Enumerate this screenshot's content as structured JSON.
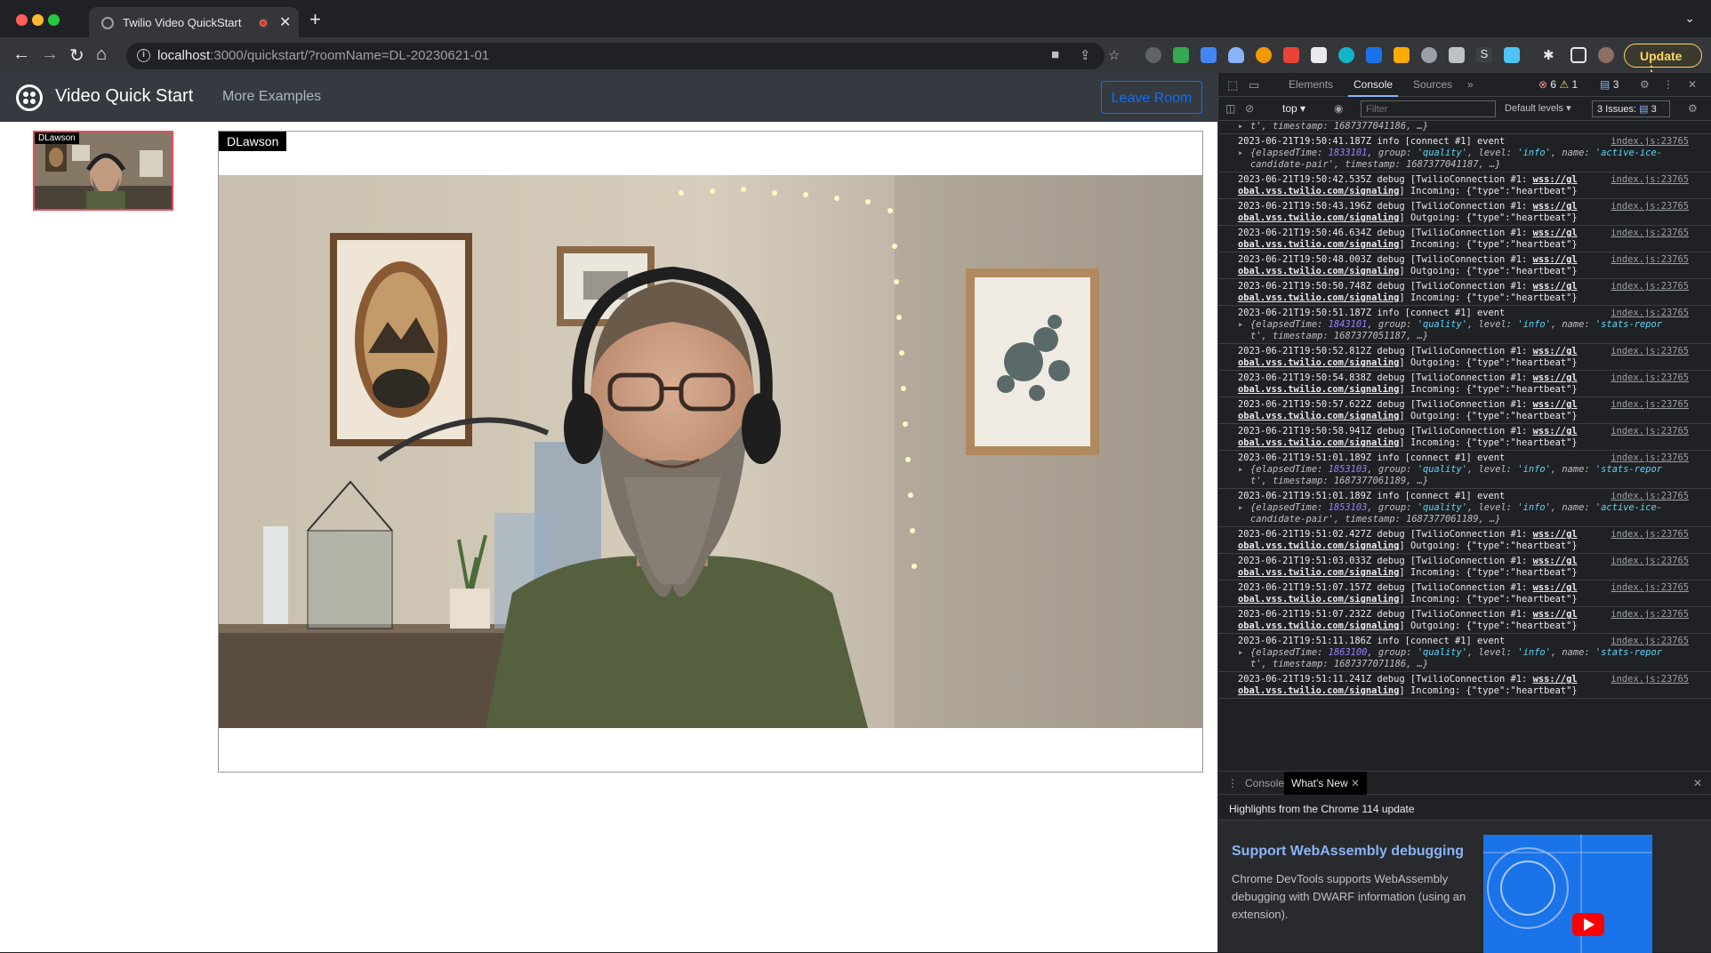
{
  "browser": {
    "tab_title": "Twilio Video QuickStart",
    "url_host": "localhost",
    "url_rest": ":3000/quickstart/?roomName=DL-20230621-01",
    "update_label": "Update"
  },
  "app": {
    "brand": "Video Quick Start",
    "more_examples": "More Examples",
    "leave_room": "Leave Room",
    "local_participant": "DLawson",
    "main_participant": "DLawson"
  },
  "devtools": {
    "tabs": [
      "Elements",
      "Console",
      "Sources"
    ],
    "error_count": "6",
    "warning_count": "1",
    "info_count": "3",
    "context": "top",
    "filter_placeholder": "Filter",
    "levels": "Default levels",
    "issues": "3 Issues:",
    "issues_count": "3",
    "truncated_line": "t', timestamp: 1687377041186, …}",
    "console_entries": [
      {
        "kind": "event",
        "ts": "2023-06-21T19:50:41.187Z",
        "src": "index.js:23765",
        "elapsed": "1833101",
        "name_val": "'active-ice-",
        "tail": "candidate-pair', timestamp: 1687377041187, …}"
      },
      {
        "kind": "hb",
        "ts": "2023-06-21T19:50:42.535Z",
        "src": "index.js:23765",
        "dir": "Incoming"
      },
      {
        "kind": "hb",
        "ts": "2023-06-21T19:50:43.196Z",
        "src": "index.js:23765",
        "dir": "Outgoing"
      },
      {
        "kind": "hb",
        "ts": "2023-06-21T19:50:46.634Z",
        "src": "index.js:23765",
        "dir": "Incoming"
      },
      {
        "kind": "hb",
        "ts": "2023-06-21T19:50:48.003Z",
        "src": "index.js:23765",
        "dir": "Outgoing"
      },
      {
        "kind": "hb",
        "ts": "2023-06-21T19:50:50.748Z",
        "src": "index.js:23765",
        "dir": "Incoming"
      },
      {
        "kind": "event",
        "ts": "2023-06-21T19:50:51.187Z",
        "src": "index.js:23765",
        "elapsed": "1843101",
        "name_val": "'stats-repor",
        "tail": "t', timestamp: 1687377051187, …}"
      },
      {
        "kind": "hb",
        "ts": "2023-06-21T19:50:52.812Z",
        "src": "index.js:23765",
        "dir": "Outgoing"
      },
      {
        "kind": "hb",
        "ts": "2023-06-21T19:50:54.838Z",
        "src": "index.js:23765",
        "dir": "Incoming"
      },
      {
        "kind": "hb",
        "ts": "2023-06-21T19:50:57.622Z",
        "src": "index.js:23765",
        "dir": "Outgoing"
      },
      {
        "kind": "hb",
        "ts": "2023-06-21T19:50:58.941Z",
        "src": "index.js:23765",
        "dir": "Incoming"
      },
      {
        "kind": "event",
        "ts": "2023-06-21T19:51:01.189Z",
        "src": "index.js:23765",
        "elapsed": "1853103",
        "name_val": "'stats-repor",
        "tail": "t', timestamp: 1687377061189, …}"
      },
      {
        "kind": "event",
        "ts": "2023-06-21T19:51:01.189Z",
        "src": "index.js:23765",
        "elapsed": "1853103",
        "name_val": "'active-ice-",
        "tail": "candidate-pair', timestamp: 1687377061189, …}"
      },
      {
        "kind": "hb",
        "ts": "2023-06-21T19:51:02.427Z",
        "src": "index.js:23765",
        "dir": "Outgoing"
      },
      {
        "kind": "hb",
        "ts": "2023-06-21T19:51:03.033Z",
        "src": "index.js:23765",
        "dir": "Incoming"
      },
      {
        "kind": "hb",
        "ts": "2023-06-21T19:51:07.157Z",
        "src": "index.js:23765",
        "dir": "Incoming"
      },
      {
        "kind": "hb",
        "ts": "2023-06-21T19:51:07.232Z",
        "src": "index.js:23765",
        "dir": "Outgoing"
      },
      {
        "kind": "event",
        "ts": "2023-06-21T19:51:11.186Z",
        "src": "index.js:23765",
        "elapsed": "1863100",
        "name_val": "'stats-repor",
        "tail": "t', timestamp: 1687377071186, …}"
      },
      {
        "kind": "hb",
        "ts": "2023-06-21T19:51:11.241Z",
        "src": "index.js:23765",
        "dir": "Incoming"
      }
    ],
    "drawer_tabs": [
      "Console",
      "What's New"
    ],
    "highlights": "Highlights from the Chrome 114 update",
    "whats_new_title": "Support WebAssembly debugging",
    "whats_new_body": "Chrome DevTools supports WebAssembly debugging with DWARF information (using an extension)."
  }
}
